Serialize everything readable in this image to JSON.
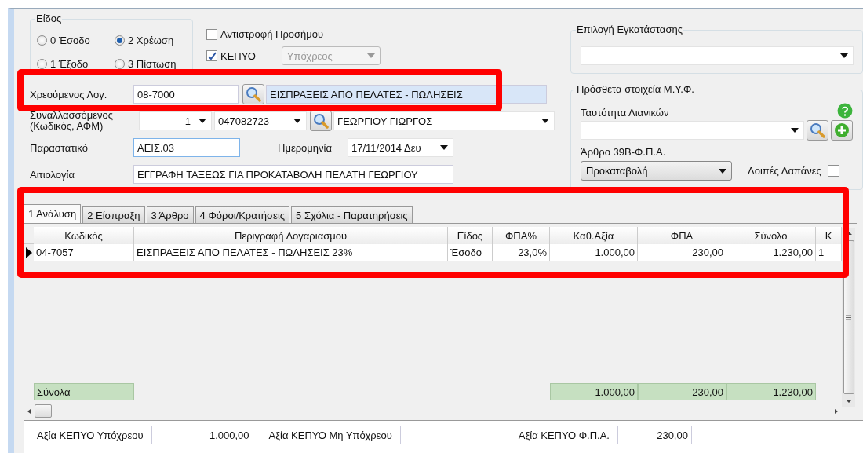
{
  "type_group": {
    "title": "Είδος",
    "options": [
      {
        "label": "0 Έσοδο",
        "selected": false
      },
      {
        "label": "2 Χρέωση",
        "selected": true
      },
      {
        "label": "1 Έξοδο",
        "selected": false
      },
      {
        "label": "3 Πίστωση",
        "selected": false
      }
    ]
  },
  "reverse_sign": {
    "label": "Αντιστροφή Προσήμου",
    "checked": false
  },
  "kepyo": {
    "label": "ΚΕΠΥΟ",
    "checked": true,
    "dropdown": {
      "value": "Υπόχρεος",
      "disabled": true
    }
  },
  "debit_account": {
    "label": "Χρεούμενος Λογ.",
    "code": "08-7000",
    "description": "ΕΙΣΠΡΑΞΕΙΣ ΑΠΟ ΠΕΛΑΤΕΣ - ΠΩΛΗΣΕΙΣ"
  },
  "counterparty": {
    "label": "Συναλλασσόμενος (Κωδικός, ΑΦΜ)",
    "code": "1",
    "tax_id": "047082723",
    "name": "ΓΕΩΡΓΙΟΥ ΓΙΩΡΓΟΣ"
  },
  "document": {
    "label": "Παραστατικό",
    "value": "ΑΕΙΣ.03",
    "date_label": "Ημερομηνία",
    "date": "17/11/2014 Δευ"
  },
  "justification": {
    "label": "Αιτιολογία",
    "value": "ΕΓΓΡΑΦΗ ΤΑΞΕΩΣ ΓΙΑ ΠΡΟΚΑΤΑΒΟΛΗ ΠΕΛΑΤΗ ΓΕΩΡΓΙΟΥ"
  },
  "installation": {
    "title": "Επιλογή Εγκατάστασης"
  },
  "myf": {
    "title": "Πρόσθετα στοιχεία Μ.Υ.Φ.",
    "retail_label": "Ταυτότητα Λιανικών",
    "article_label": "Άρθρο 39Β-Φ.Π.Α.",
    "article_value": "Προκαταβολή",
    "other_expenses": {
      "label": "Λοιπές Δαπάνες",
      "checked": false
    }
  },
  "tabs": [
    {
      "label": "1 Ανάλυση",
      "selected": true
    },
    {
      "label": "2 Είσπραξη",
      "selected": false
    },
    {
      "label": "3 Άρθρο",
      "selected": false
    },
    {
      "label": "4 Φόροι/Κρατήσεις",
      "selected": false
    },
    {
      "label": "5 Σχόλια - Παρατηρήσεις",
      "selected": false
    }
  ],
  "table": {
    "columns": [
      "Κωδικός",
      "Περιγραφή Λογαριασμού",
      "Είδος",
      "ΦΠΑ%",
      "Καθ.Αξία",
      "ΦΠΑ",
      "Σύνολο",
      "Κ"
    ],
    "rows": [
      {
        "selected": true,
        "cells": [
          "04-7057",
          "ΕΙΣΠΡΑΞΕΙΣ ΑΠΟ ΠΕΛΑΤΕΣ - ΠΩΛΗΣΕΙΣ 23%",
          "Έσοδο",
          "23,0%",
          "1.000,00",
          "230,00",
          "1.230,00",
          "1"
        ]
      }
    ],
    "totals": [
      {
        "kind": "total",
        "text": "Σύνολα"
      },
      {
        "kind": "empty"
      },
      {
        "kind": "empty"
      },
      {
        "kind": "empty"
      },
      {
        "kind": "total",
        "text": "1.000,00"
      },
      {
        "kind": "total",
        "text": "230,00"
      },
      {
        "kind": "total",
        "text": "1.230,00"
      },
      {
        "kind": "empty"
      }
    ]
  },
  "bottom": [
    {
      "label": "Αξία ΚΕΠΥΟ Υπόχρεου",
      "value": "1.000,00"
    },
    {
      "label": "Αξία ΚΕΠΥΟ Μη Υπόχρεου"
    },
    {
      "label": "Αξία ΚΕΠΥΟ Φ.Π.Α.",
      "value": "230,00"
    }
  ]
}
